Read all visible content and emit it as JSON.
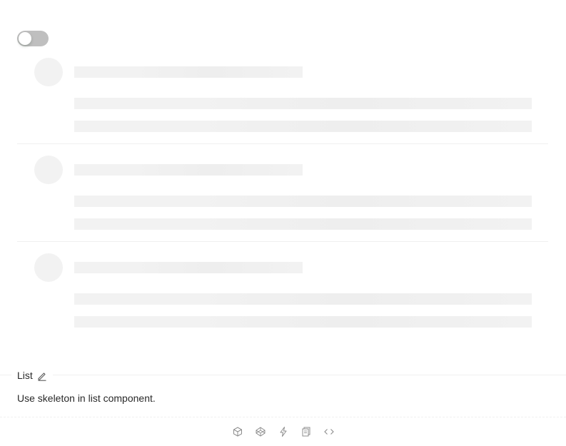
{
  "demo": {
    "toggle": {
      "checked": false
    },
    "list": {
      "item_count": 3
    }
  },
  "meta": {
    "title": "List",
    "description": "Use skeleton in list component."
  },
  "actions": {
    "icons": [
      "codesandbox-icon",
      "codepen-icon",
      "stackblitz-icon",
      "copy-icon",
      "expand-code-icon"
    ]
  },
  "colors": {
    "skeleton": "#f2f2f2",
    "switch_off": "#bfbfbf",
    "icon": "#8c8c8c"
  }
}
